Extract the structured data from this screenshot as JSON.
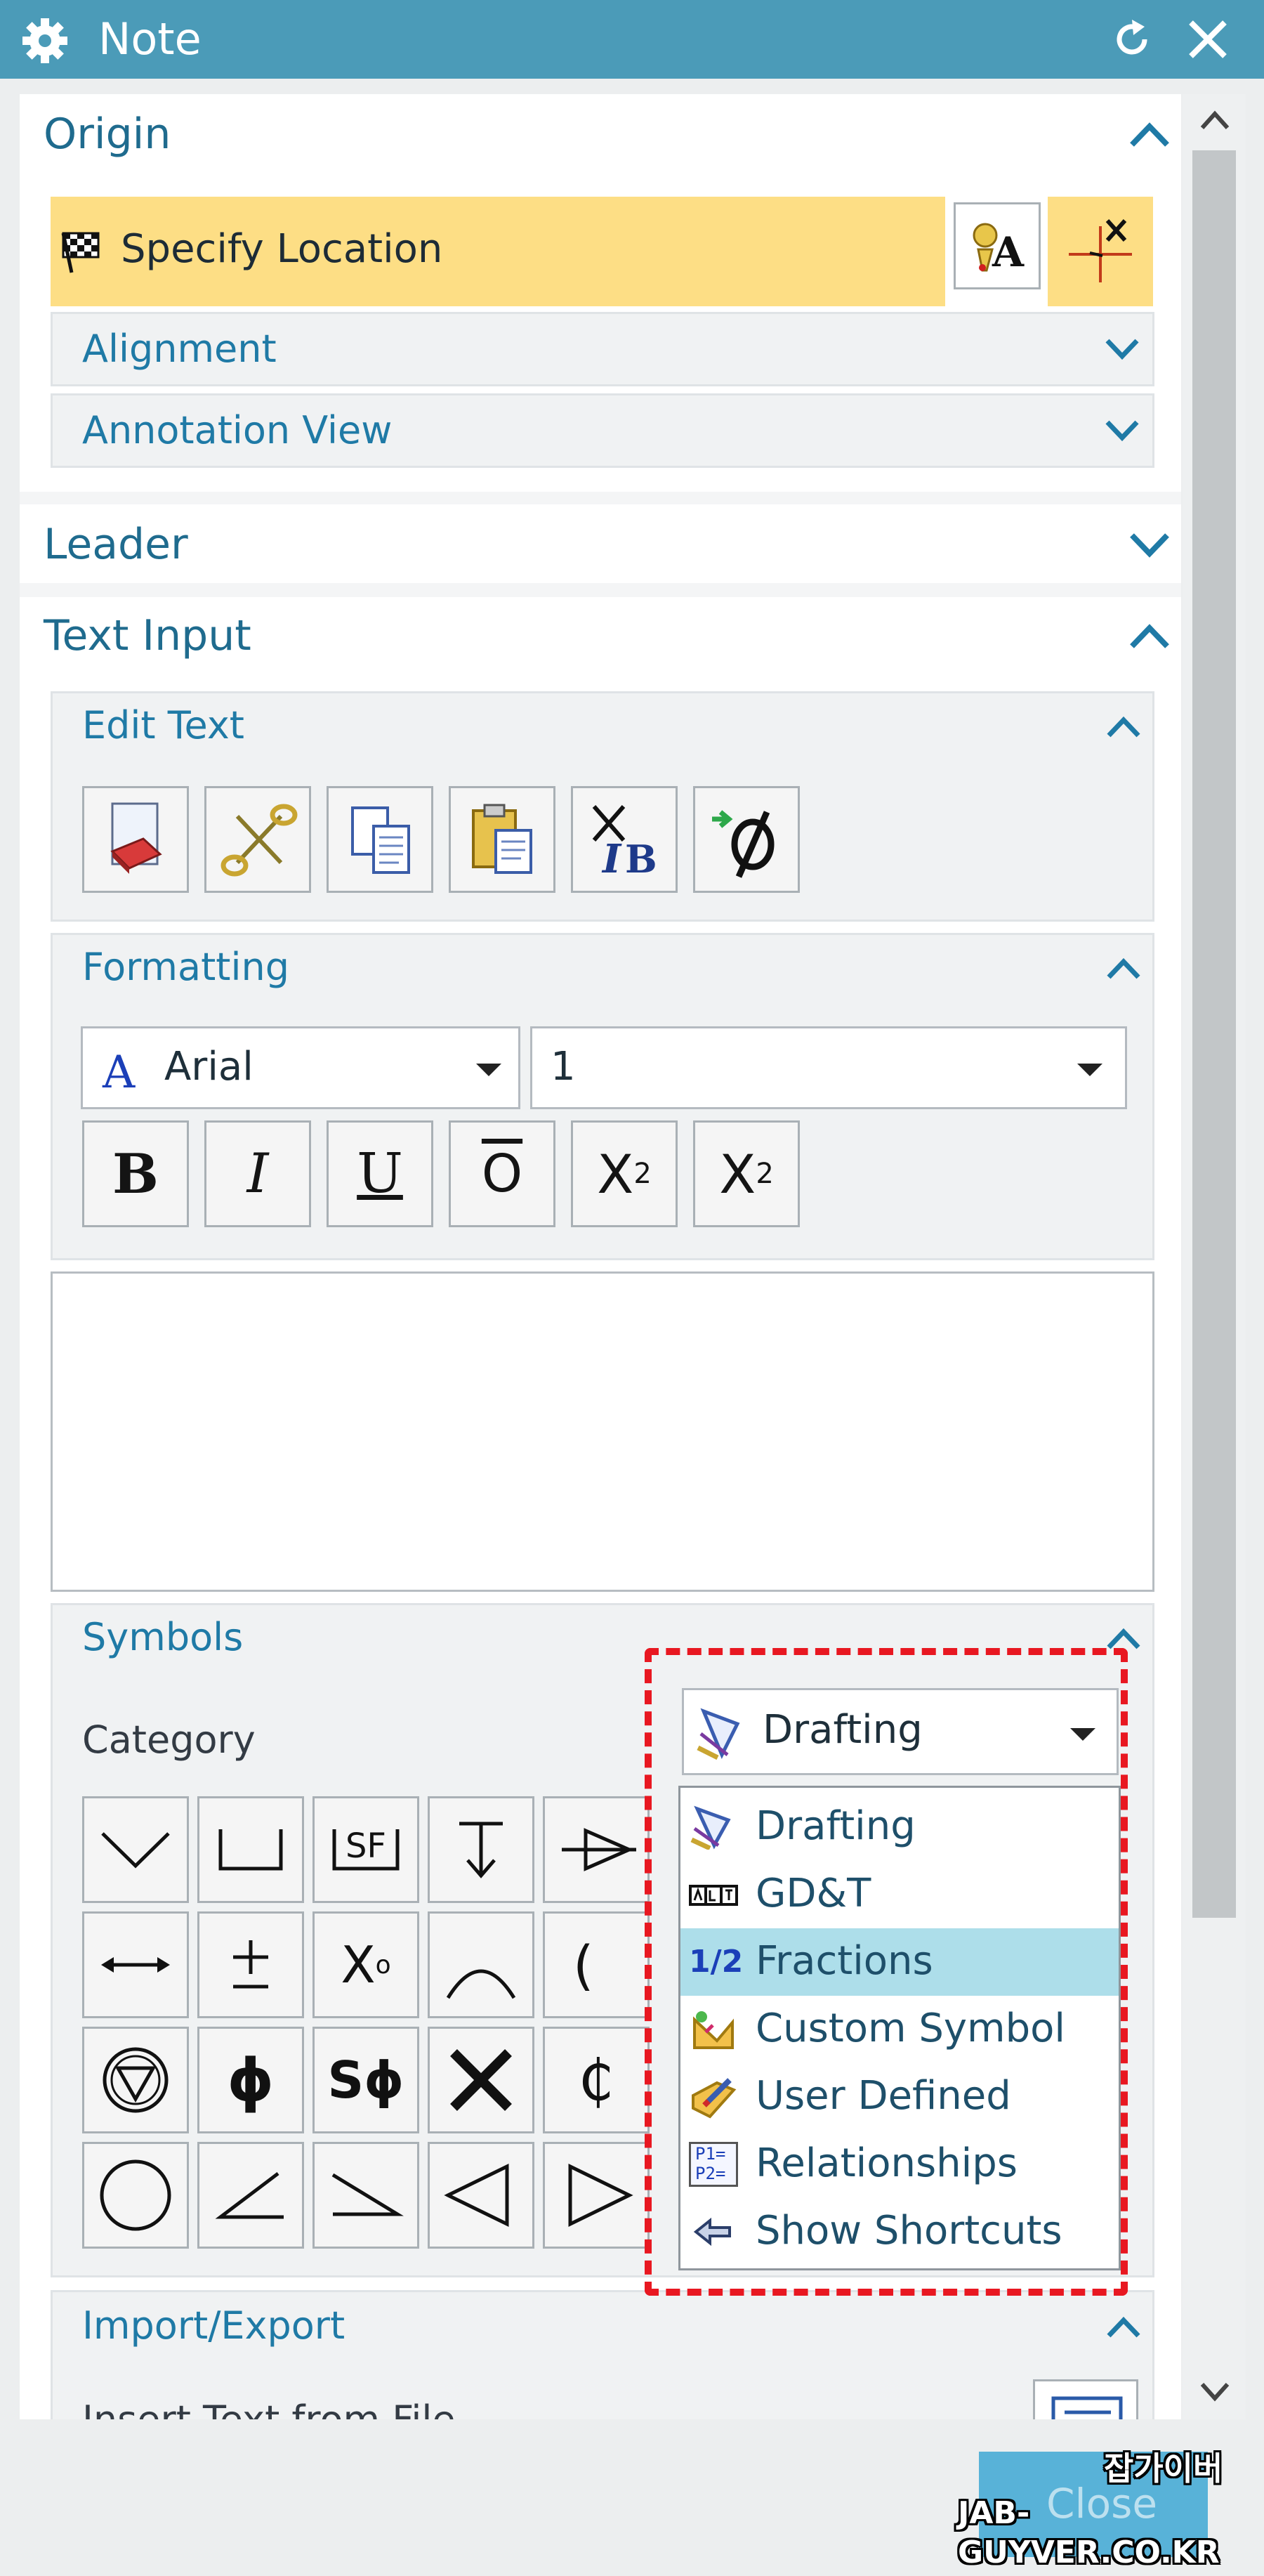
{
  "window": {
    "title": "Note"
  },
  "origin": {
    "header": "Origin",
    "specify_location": "Specify Location",
    "alignment": "Alignment",
    "annotation_view": "Annotation View"
  },
  "leader": {
    "header": "Leader"
  },
  "text_input": {
    "header": "Text Input",
    "edit_text": {
      "header": "Edit Text"
    },
    "formatting": {
      "header": "Formatting",
      "font": "Arial",
      "size": "1",
      "buttons": [
        "B",
        "I",
        "U",
        "O",
        "X",
        "2",
        "X",
        "2"
      ]
    },
    "text_area_value": ""
  },
  "symbols": {
    "header": "Symbols",
    "category_label": "Category",
    "category_selected": "Drafting",
    "grid_text": {
      "sf": "SF",
      "x_degree": "X",
      "degree": "o",
      "paren": "(",
      "phi": "ϕ",
      "s_phi": "Sϕ",
      "centerline": "₵"
    },
    "dropdown_items": [
      {
        "label": "Drafting",
        "icon": "drafting-icon"
      },
      {
        "label": "GD&T",
        "icon": "gdt-icon"
      },
      {
        "label": "Fractions",
        "icon": "fraction-icon",
        "icon_text": "1/2",
        "selected": true
      },
      {
        "label": "Custom Symbol",
        "icon": "custom-symbol-icon"
      },
      {
        "label": "User Defined",
        "icon": "user-defined-icon"
      },
      {
        "label": "Relationships",
        "icon": "relationships-icon",
        "icon_text_1": "P1=",
        "icon_text_2": "P2="
      },
      {
        "label": "Show Shortcuts",
        "icon": "arrow-left-icon"
      }
    ]
  },
  "import_export": {
    "header": "Import/Export",
    "partial_label": "Insert Text from File"
  },
  "footer": {
    "close_label": "Close"
  },
  "watermark": {
    "line1": "잡가이버",
    "line2": "JAB-GUYVER.CO.KR"
  },
  "colors": {
    "titlebar": "#4b9bb8",
    "specify_highlight": "#fdde85",
    "selected_item": "#addeea",
    "annotation_red": "#e81821"
  }
}
